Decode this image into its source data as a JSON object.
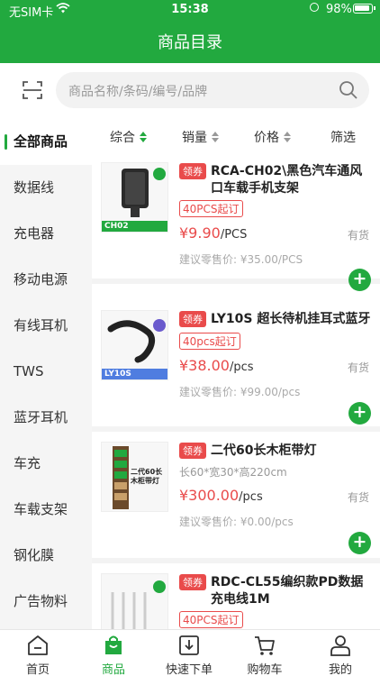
{
  "status_bar": {
    "carrier": "无SIM卡",
    "time": "15:38",
    "battery": "98%"
  },
  "header": {
    "title": "商品目录"
  },
  "search": {
    "placeholder": "商品名称/条码/编号/品牌"
  },
  "categories": [
    {
      "label": "全部商品",
      "active": true
    },
    {
      "label": "数据线"
    },
    {
      "label": "充电器"
    },
    {
      "label": "移动电源"
    },
    {
      "label": "有线耳机"
    },
    {
      "label": "TWS"
    },
    {
      "label": "蓝牙耳机"
    },
    {
      "label": "车充"
    },
    {
      "label": "车载支架"
    },
    {
      "label": "钢化膜"
    },
    {
      "label": "广告物料"
    }
  ],
  "sort": {
    "comprehensive": "综合",
    "sales": "销量",
    "price": "价格",
    "filter": "筛选"
  },
  "products": [
    {
      "coupon": "领券",
      "name": "RCA-CH02\\黑色汽车通风口车载手机支架",
      "moq": "40PCS起订",
      "price": "¥9.90",
      "unit": "/PCS",
      "stock": "有货",
      "retail": "建议零售价: ¥35.00/PCS",
      "thumb_label": "CH02"
    },
    {
      "coupon": "领券",
      "name": "LY10S 超长待机挂耳式蓝牙",
      "moq": "40pcs起订",
      "price": "¥38.00",
      "unit": "/pcs",
      "stock": "有货",
      "retail": "建议零售价: ¥99.00/pcs",
      "thumb_label": "LY10S"
    },
    {
      "coupon": "领券",
      "name": "二代60长木柜带灯",
      "spec": "长60*宽30*高220cm",
      "price": "¥300.00",
      "unit": "/pcs",
      "stock": "有货",
      "retail": "建议零售价: ¥0.00/pcs",
      "thumb_label": "二代60长木柜带灯"
    },
    {
      "coupon": "领券",
      "name": "RDC-CL55编织款PD数据充电线1M",
      "moq": "40PCS起订"
    }
  ],
  "tabs": [
    {
      "label": "首页",
      "icon": "home-icon"
    },
    {
      "label": "商品",
      "icon": "bag-icon",
      "active": true
    },
    {
      "label": "快速下单",
      "icon": "quick-order-icon"
    },
    {
      "label": "购物车",
      "icon": "cart-icon"
    },
    {
      "label": "我的",
      "icon": "user-icon"
    }
  ],
  "colors": {
    "brand": "#22a93f",
    "accent_red": "#e94b4b"
  }
}
